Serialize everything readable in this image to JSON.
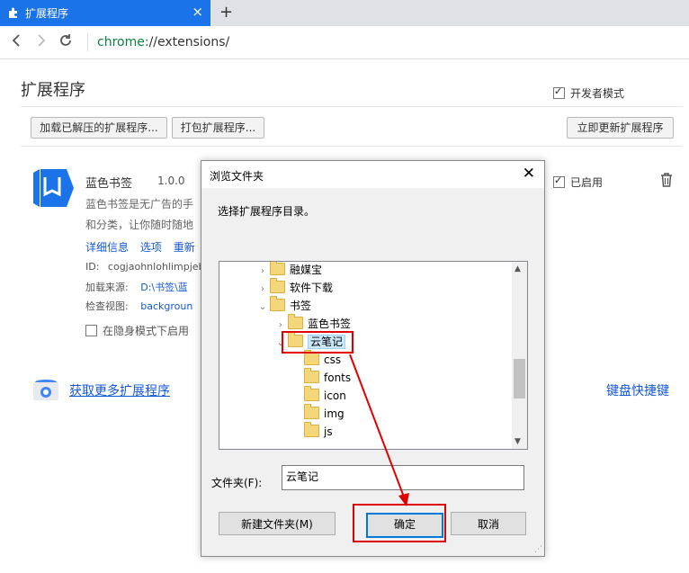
{
  "browser": {
    "tab_title": "扩展程序",
    "tab_close": "×",
    "new_tab": "+",
    "url_scheme": "chrome:",
    "url_rest": "//extensions/"
  },
  "page": {
    "title": "扩展程序",
    "developer_mode_label": "开发者模式",
    "developer_mode_checked": true,
    "buttons": {
      "load_unpacked": "加载已解压的扩展程序...",
      "pack": "打包扩展程序...",
      "update_now": "立即更新扩展程序"
    },
    "extension": {
      "name": "蓝色书签",
      "version": "1.0.0",
      "desc_line1": "蓝色书签是无广告的手",
      "desc_line2": "和分类，让你随时随地",
      "links": [
        "详细信息",
        "选项",
        "重新"
      ],
      "id_label": "ID:",
      "id_value": "cogjaohnlohlimpjeb",
      "source_label": "加载来源:",
      "source_value": "D:\\书签\\蓝",
      "inspect_label": "检查视图:",
      "inspect_value": "backgroun",
      "incognito_label": "在隐身模式下启用",
      "enabled_label": "已启用"
    },
    "more_extensions": "获取更多扩展程序",
    "keyboard_shortcuts": "键盘快捷键"
  },
  "dialog": {
    "title": "浏览文件夹",
    "close": "✕",
    "instruction": "选择扩展程序目录。",
    "tree": [
      {
        "label": "融媒宝",
        "chev": "›",
        "indent": 1
      },
      {
        "label": "软件下载",
        "chev": "›",
        "indent": 1
      },
      {
        "label": "书签",
        "chev": "⌄",
        "indent": 1
      },
      {
        "label": "蓝色书签",
        "chev": "›",
        "indent": 2
      },
      {
        "label": "云笔记",
        "chev": "⌄",
        "indent": 2,
        "selected": true
      },
      {
        "label": "css",
        "chev": "",
        "indent": 3
      },
      {
        "label": "fonts",
        "chev": "",
        "indent": 3
      },
      {
        "label": "icon",
        "chev": "",
        "indent": 3
      },
      {
        "label": "img",
        "chev": "",
        "indent": 3
      },
      {
        "label": "js",
        "chev": "",
        "indent": 3
      }
    ],
    "folder_label": "文件夹(F):",
    "folder_value": "云笔记",
    "new_folder_button": "新建文件夹(M)",
    "ok_button": "确定",
    "cancel_button": "取消"
  },
  "colors": {
    "annotation": "#e00000",
    "tab_active": "#1a73e8",
    "link": "#1558d6"
  }
}
